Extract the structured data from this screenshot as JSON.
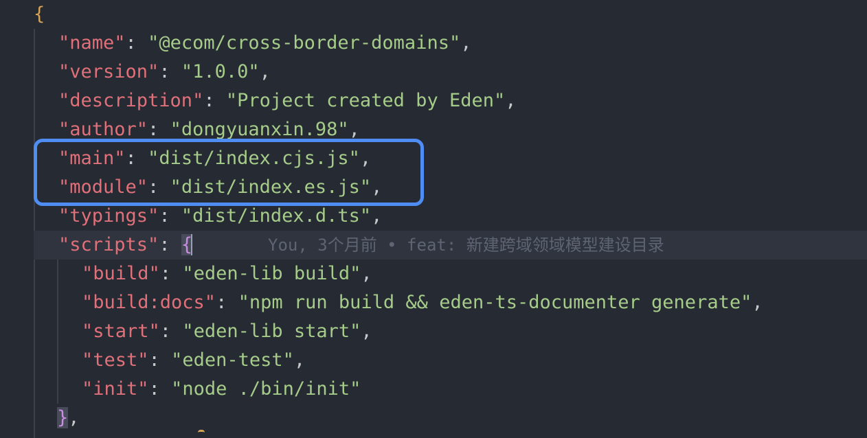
{
  "editor": {
    "open_brace": "{",
    "name_key": "\"name\"",
    "name_value": "\"@ecom/cross-border-domains\"",
    "version_key": "\"version\"",
    "version_value": "\"1.0.0\"",
    "description_key": "\"description\"",
    "description_value": "\"Project created by Eden\"",
    "author_key": "\"author\"",
    "author_value": "\"dongyuanxin.98\"",
    "main_key": "\"main\"",
    "main_value": "\"dist/index.cjs.js\"",
    "module_key": "\"module\"",
    "module_value": "\"dist/index.es.js\"",
    "typings_key": "\"typings\"",
    "typings_value": "\"dist/index.d.ts\"",
    "scripts_key": "\"scripts\"",
    "scripts_open": "{",
    "blame_text": "You, 3个月前 • feat: 新建跨域领域模型建设目录",
    "build_key": "\"build\"",
    "build_value": "\"eden-lib build\"",
    "build_docs_key": "\"build:docs\"",
    "build_docs_value": "\"npm run build && eden-ts-documenter generate\"",
    "start_key": "\"start\"",
    "start_value": "\"eden-lib start\"",
    "test_key": "\"test\"",
    "test_value": "\"eden-test\"",
    "init_key": "\"init\"",
    "init_value": "\"node ./bin/init\"",
    "scripts_close": "}",
    "colon": ": ",
    "comma": ","
  },
  "colors": {
    "background": "#262a33",
    "key": "#e0707a",
    "string": "#a6cc8a",
    "brace": "#d6a457",
    "highlight_border": "#4f8df2"
  }
}
